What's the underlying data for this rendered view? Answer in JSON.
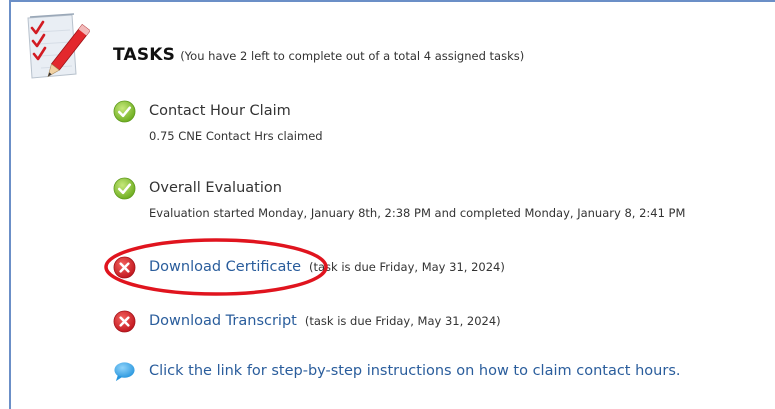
{
  "tasks_section": {
    "title": "TASKS",
    "subtitle": "(You have 2 left to complete out of a total 4 assigned tasks)",
    "icon": "checklist-pencil-icon"
  },
  "tasks": [
    {
      "name": "Contact Hour Claim",
      "status": "complete",
      "status_icon": "green-check-icon",
      "detail": "0.75 CNE Contact Hrs claimed"
    },
    {
      "name": "Overall Evaluation",
      "status": "complete",
      "status_icon": "green-check-icon",
      "detail": "Evaluation started Monday, January 8th, 2:38 PM and completed Monday, January 8, 2:41 PM"
    },
    {
      "name": "Download Certificate",
      "status": "incomplete",
      "status_icon": "red-x-icon",
      "due": "(task is due Friday, May 31, 2024)"
    },
    {
      "name": "Download Transcript",
      "status": "incomplete",
      "status_icon": "red-x-icon",
      "due": "(task is due Friday, May 31, 2024)"
    }
  ],
  "instructions_link": {
    "text": "Click the link for step-by-step instructions on how to claim contact hours.",
    "icon": "speech-bubble-icon"
  },
  "colors": {
    "link": "#2a5d9c",
    "check_green": "#8cc63f",
    "x_red": "#d8262e",
    "annotation_red": "#e0141e",
    "border_blue": "#6b8fc7",
    "bubble_blue": "#3aa7e6"
  }
}
